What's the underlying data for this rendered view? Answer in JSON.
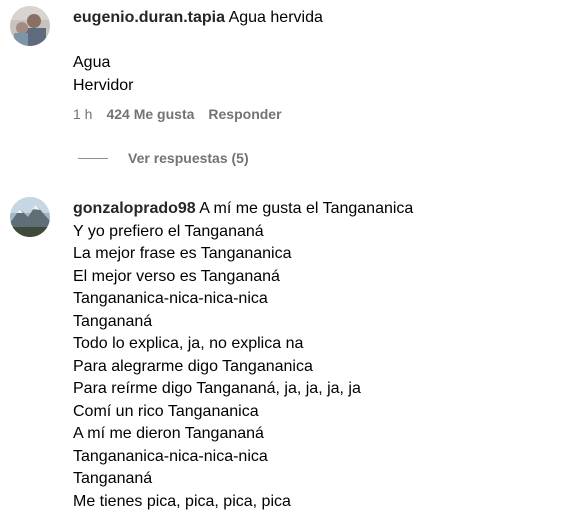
{
  "comments": [
    {
      "username": "eugenio.duran.tapia",
      "first_text": "Agua hervida",
      "lines": [
        "",
        "Agua",
        "Hervidor"
      ],
      "time": "1 h",
      "likes": "424 Me gusta",
      "reply_label": "Responder",
      "view_replies": "Ver respuestas (5)"
    },
    {
      "username": "gonzaloprado98",
      "first_text": "A mí me gusta el Tangananica",
      "lines": [
        "Y yo prefiero el Tangananá",
        "La mejor frase es Tangananica",
        "El mejor verso es Tangananá",
        "Tangananica-nica-nica-nica",
        "Tangananá",
        "Todo lo explica, ja, no explica na",
        "Para alegrarme digo Tangananica",
        "Para reírme digo Tangananá, ja, ja, ja, ja",
        "Comí un rico Tangananica",
        "A mí me dieron Tangananá",
        "Tangananica-nica-nica-nica",
        "Tangananá",
        "Me tienes pica, pica, pica, pica"
      ]
    }
  ]
}
